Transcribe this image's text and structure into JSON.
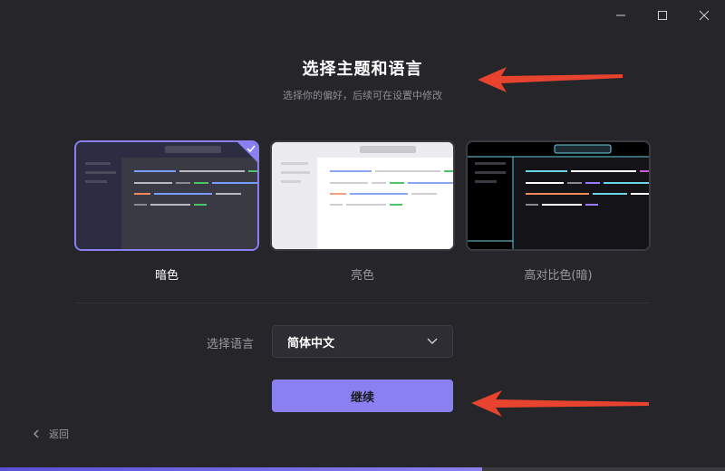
{
  "header": {
    "title": "选择主题和语言",
    "subtitle": "选择你的偏好，后续可在设置中修改"
  },
  "window_controls": [
    "minimize-icon",
    "maximize-icon",
    "close-icon"
  ],
  "themes": [
    {
      "label": "暗色",
      "selected": true
    },
    {
      "label": "亮色",
      "selected": false
    },
    {
      "label": "高对比色(暗)",
      "selected": false
    }
  ],
  "language": {
    "label": "选择语言",
    "value": "简体中文"
  },
  "continue_label": "继续",
  "back_label": "返回",
  "progress": {
    "percent": 66.5
  },
  "colors": {
    "accent": "#8a80f2",
    "annotation_arrow": "#e8432e",
    "background": "#25252a"
  }
}
